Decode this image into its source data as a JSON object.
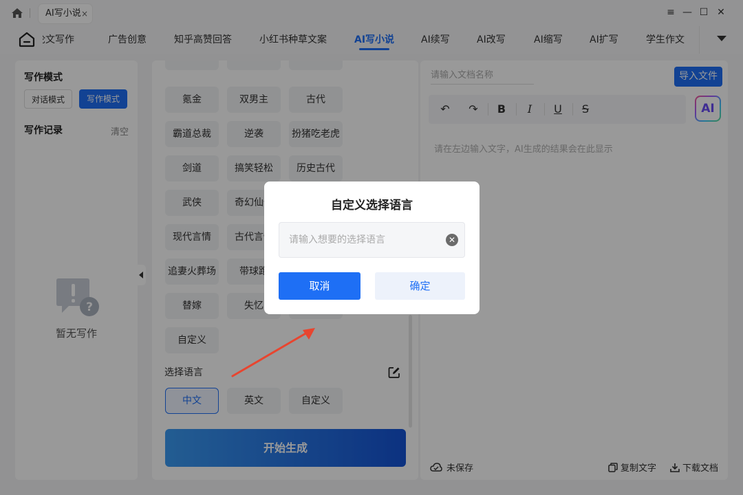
{
  "titlebar": {
    "tab_title": "AI写小说",
    "tab_close": "×",
    "window_controls": [
      "≡",
      "—",
      "☐",
      "✕"
    ]
  },
  "nav": {
    "items": [
      "论文写作",
      "广告创意",
      "知乎高赞回答",
      "小红书种草文案",
      "AI写小说",
      "AI续写",
      "AI改写",
      "AI缩写",
      "AI扩写",
      "学生作文"
    ],
    "active": "AI写小说"
  },
  "left": {
    "mode_title": "写作模式",
    "modes": [
      "对话模式",
      "写作模式"
    ],
    "active_mode": "写作模式",
    "records_title": "写作记录",
    "clear_label": "清空",
    "empty_text": "暂无写作"
  },
  "middle": {
    "genre_tags": [
      "氪金",
      "双男主",
      "古代",
      "霸道总裁",
      "逆袭",
      "扮猪吃老虎",
      "剑道",
      "搞笑轻松",
      "历史古代",
      "武侠",
      "奇幻仙侠",
      "",
      "现代言情",
      "古代言情",
      "",
      "追妻火葬场",
      "带球跑",
      "",
      "替嫁",
      "失忆",
      "",
      "自定义"
    ],
    "language_label": "选择语言",
    "languages": [
      "中文",
      "英文",
      "自定义"
    ],
    "selected_language": "中文",
    "generate_label": "开始生成"
  },
  "right": {
    "docname_placeholder": "请输入文档名称",
    "import_label": "导入文件",
    "toolbar": [
      "↶",
      "↷",
      "B",
      "I",
      "U",
      "S"
    ],
    "ai_badge": "AI",
    "editor_placeholder": "请在左边输入文字，AI生成的结果会在此显示",
    "save_status": "未保存",
    "copy_label": "复制文字",
    "download_label": "下载文档"
  },
  "dialog": {
    "title": "自定义选择语言",
    "input_placeholder": "请输入想要的选择语言",
    "input_value": "",
    "cancel_label": "取消",
    "confirm_label": "确定"
  },
  "colors": {
    "accent": "#1e6ff5",
    "overlay": "rgba(0,0,0,0.40)",
    "arrow": "#e8452f"
  }
}
